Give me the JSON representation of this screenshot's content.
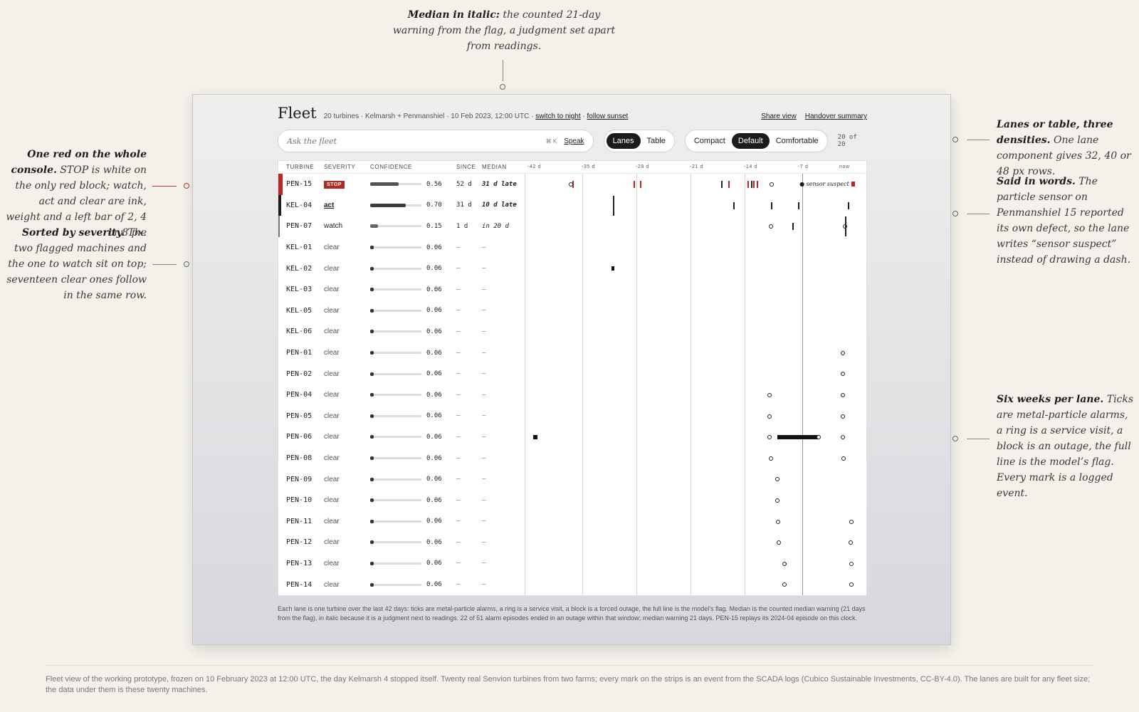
{
  "annotations": {
    "top": {
      "title": "Median in italic:",
      "body": " the counted 21-day warning from the flag, a judgment set apart from readings."
    },
    "left1": {
      "title": "One red on the whole console.",
      "body": " STOP is white on the only red block; watch, act and clear are ink, weight and a left bar of 2, 4 or 8 px."
    },
    "left2": {
      "title": "Sorted by severity.",
      "body": " The two flagged machines and the one to watch sit on top; seventeen clear ones follow in the same row."
    },
    "right1": {
      "title": "Lanes or table, three densities.",
      "body": " One lane component gives 32, 40 or 48 px rows."
    },
    "right2": {
      "title": "Said in words.",
      "body": " The particle sensor on Penmanshiel 15 reported its own defect, so the lane writes “sensor suspect” instead of drawing a dash."
    },
    "right3": {
      "title": "Six weeks per lane.",
      "body": " Ticks are metal-particle alarms, a ring is a service visit, a block is an outage, the full line is the model’s flag. Every mark is a logged event."
    }
  },
  "header": {
    "title": "Fleet",
    "meta": "20 turbines · Kelmarsh + Penmanshiel · 10 Feb 2023, 12:00 UTC ·",
    "night": "switch to night",
    "sunset": "follow sunset",
    "share": "Share view",
    "handover": "Handover summary"
  },
  "toolbar": {
    "search_placeholder": "Ask the fleet",
    "shortcut": "⌘ K",
    "speak": "Speak",
    "view_lanes": "Lanes",
    "view_table": "Table",
    "density_compact": "Compact",
    "density_default": "Default",
    "density_comfortable": "Comfortable",
    "count": "20 of 20"
  },
  "columns": {
    "turbine": "TURBINE",
    "severity": "SEVERITY",
    "confidence": "CONFIDENCE",
    "since": "SINCE",
    "median": "MEDIAN"
  },
  "timeline": {
    "ticks": [
      "-42 d",
      "-35 d",
      "-28 d",
      "-21 d",
      "-14 d",
      "-7 d",
      "now"
    ],
    "range_days": 42,
    "flag_day": -6.5
  },
  "rows": [
    {
      "id": "PEN-15",
      "severity": "STOP",
      "level": "stop",
      "confidence": 0.56,
      "conf_text": "0.56",
      "since": "52 d",
      "median": "31 d late",
      "events": {
        "alarms_red": [
          -36.3,
          -28.4,
          -27.5,
          -16.1,
          -13.6,
          -12.9,
          -12.4
        ],
        "alarms": [
          -17.0,
          -13.2
        ],
        "rings": [
          -36.5,
          -10.5
        ],
        "suspect": "sensor suspect",
        "suspect_at": -6.9,
        "red_end": true
      }
    },
    {
      "id": "KEL-04",
      "severity": "act",
      "level": "act",
      "confidence": 0.7,
      "conf_text": "0.70",
      "since": "31 d",
      "median": "10 d late",
      "events": {
        "flags": [
          -31.0
        ],
        "alarms": [
          -15.5,
          -10.6,
          -7.1,
          -0.6
        ]
      }
    },
    {
      "id": "PEN-07",
      "severity": "watch",
      "level": "watch",
      "confidence": 0.15,
      "conf_text": "0.15",
      "since": "1 d",
      "median": "in 20 d",
      "events": {
        "rings": [
          -10.6,
          -1.0
        ],
        "alarms": [
          -7.8
        ],
        "flags": [
          -1.0
        ]
      }
    },
    {
      "id": "KEL-01",
      "severity": "clear",
      "level": "clear",
      "confidence": 0.06,
      "conf_text": "0.06",
      "since": "–",
      "median": "–",
      "events": {}
    },
    {
      "id": "KEL-02",
      "severity": "clear",
      "level": "clear",
      "confidence": 0.06,
      "conf_text": "0.06",
      "since": "–",
      "median": "–",
      "events": {
        "blocks": [
          [
            -31.2,
            -30.9
          ]
        ]
      }
    },
    {
      "id": "KEL-03",
      "severity": "clear",
      "level": "clear",
      "confidence": 0.06,
      "conf_text": "0.06",
      "since": "–",
      "median": "–",
      "events": {}
    },
    {
      "id": "KEL-05",
      "severity": "clear",
      "level": "clear",
      "confidence": 0.06,
      "conf_text": "0.06",
      "since": "–",
      "median": "–",
      "events": {}
    },
    {
      "id": "KEL-06",
      "severity": "clear",
      "level": "clear",
      "confidence": 0.06,
      "conf_text": "0.06",
      "since": "–",
      "median": "–",
      "events": {}
    },
    {
      "id": "PEN-01",
      "severity": "clear",
      "level": "clear",
      "confidence": 0.06,
      "conf_text": "0.06",
      "since": "–",
      "median": "–",
      "events": {
        "rings": [
          -1.3
        ]
      }
    },
    {
      "id": "PEN-02",
      "severity": "clear",
      "level": "clear",
      "confidence": 0.06,
      "conf_text": "0.06",
      "since": "–",
      "median": "–",
      "events": {
        "rings": [
          -1.3
        ]
      }
    },
    {
      "id": "PEN-04",
      "severity": "clear",
      "level": "clear",
      "confidence": 0.06,
      "conf_text": "0.06",
      "since": "–",
      "median": "–",
      "events": {
        "rings": [
          -10.8,
          -1.3
        ]
      }
    },
    {
      "id": "PEN-05",
      "severity": "clear",
      "level": "clear",
      "confidence": 0.06,
      "conf_text": "0.06",
      "since": "–",
      "median": "–",
      "events": {
        "rings": [
          -10.8,
          -1.3
        ]
      }
    },
    {
      "id": "PEN-06",
      "severity": "clear",
      "level": "clear",
      "confidence": 0.06,
      "conf_text": "0.06",
      "since": "–",
      "median": "–",
      "events": {
        "blocks": [
          [
            -41.4,
            -40.8
          ],
          [
            -9.8,
            -4.4
          ]
        ],
        "rings": [
          -10.8,
          -4.4,
          -1.3
        ]
      }
    },
    {
      "id": "PEN-08",
      "severity": "clear",
      "level": "clear",
      "confidence": 0.06,
      "conf_text": "0.06",
      "since": "–",
      "median": "–",
      "events": {
        "rings": [
          -10.6,
          -1.2
        ]
      }
    },
    {
      "id": "PEN-09",
      "severity": "clear",
      "level": "clear",
      "confidence": 0.06,
      "conf_text": "0.06",
      "since": "–",
      "median": "–",
      "events": {
        "rings": [
          -9.8
        ]
      }
    },
    {
      "id": "PEN-10",
      "severity": "clear",
      "level": "clear",
      "confidence": 0.06,
      "conf_text": "0.06",
      "since": "–",
      "median": "–",
      "events": {
        "rings": [
          -9.8
        ]
      }
    },
    {
      "id": "PEN-11",
      "severity": "clear",
      "level": "clear",
      "confidence": 0.06,
      "conf_text": "0.06",
      "since": "–",
      "median": "–",
      "events": {
        "rings": [
          -9.7,
          -0.2
        ]
      }
    },
    {
      "id": "PEN-12",
      "severity": "clear",
      "level": "clear",
      "confidence": 0.06,
      "conf_text": "0.06",
      "since": "–",
      "median": "–",
      "events": {
        "rings": [
          -9.6,
          -0.3
        ]
      }
    },
    {
      "id": "PEN-13",
      "severity": "clear",
      "level": "clear",
      "confidence": 0.06,
      "conf_text": "0.06",
      "since": "–",
      "median": "–",
      "events": {
        "rings": [
          -8.8,
          -0.2
        ]
      }
    },
    {
      "id": "PEN-14",
      "severity": "clear",
      "level": "clear",
      "confidence": 0.06,
      "conf_text": "0.06",
      "since": "–",
      "median": "–",
      "events": {
        "rings": [
          -8.8,
          -0.2
        ]
      }
    }
  ],
  "footnote": "Each lane is one turbine over the last 42 days: ticks are metal-particle alarms, a ring is a service visit, a block is a forced outage, the full line is the model's flag. Median is the counted median warning (21 days from the flag), in italic because it is a judgment next to readings. 22 of 51 alarm episodes ended in an outage within that window; median warning 21 days. PEN-15 replays its 2024-04 episode on this clock.",
  "caption": "Fleet view of the working prototype, frozen on 10 February 2023 at 12:00 UTC, the day Kelmarsh 4 stopped itself. Twenty real Senvion turbines from two farms; every mark on the strips is an event from the SCADA logs (Cubico Sustainable Investments, CC-BY-4.0). The lanes are built for any fleet size; the data under them is these twenty machines.",
  "colors": {
    "stop": "#b52a25",
    "ink": "#1c1c1c"
  }
}
